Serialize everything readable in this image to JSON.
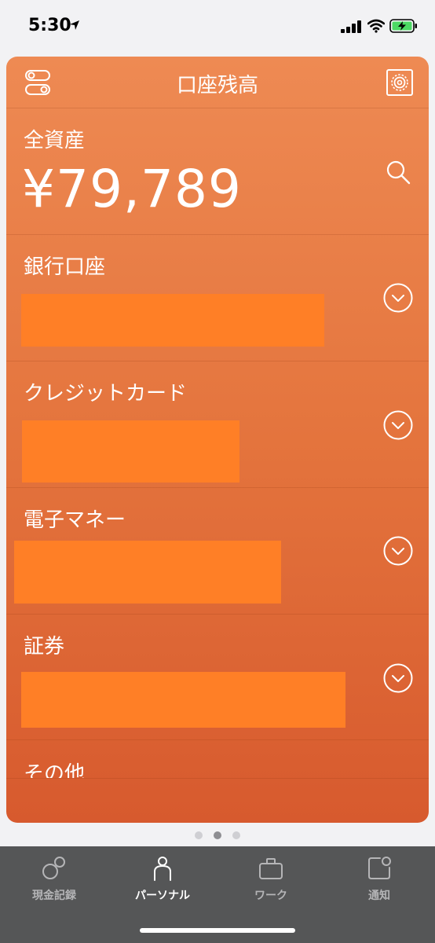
{
  "status_bar": {
    "time": "5:30",
    "icons": [
      "location-arrow-icon",
      "cellular-signal-icon",
      "wifi-icon",
      "battery-charging-icon"
    ],
    "battery_color": "#4cd964"
  },
  "card": {
    "title": "口座残高",
    "colors": {
      "gradient_top": "#ee8a53",
      "gradient_bottom": "#d75a2e",
      "redaction": "#ff7f26"
    },
    "total": {
      "label": "全資産",
      "amount": "¥79,789"
    },
    "sections": [
      {
        "label": "銀行口座"
      },
      {
        "label": "クレジットカード"
      },
      {
        "label": "電子マネー"
      },
      {
        "label": "証券"
      },
      {
        "label": "その他"
      }
    ]
  },
  "pager": {
    "pages": 3,
    "current": 2
  },
  "tab_bar": {
    "tabs": [
      {
        "label": "現金記録",
        "icon": "cash-record-icon",
        "active": false
      },
      {
        "label": "パーソナル",
        "icon": "person-icon",
        "active": true
      },
      {
        "label": "ワーク",
        "icon": "briefcase-icon",
        "active": false
      },
      {
        "label": "通知",
        "icon": "notification-icon",
        "active": false
      }
    ]
  }
}
